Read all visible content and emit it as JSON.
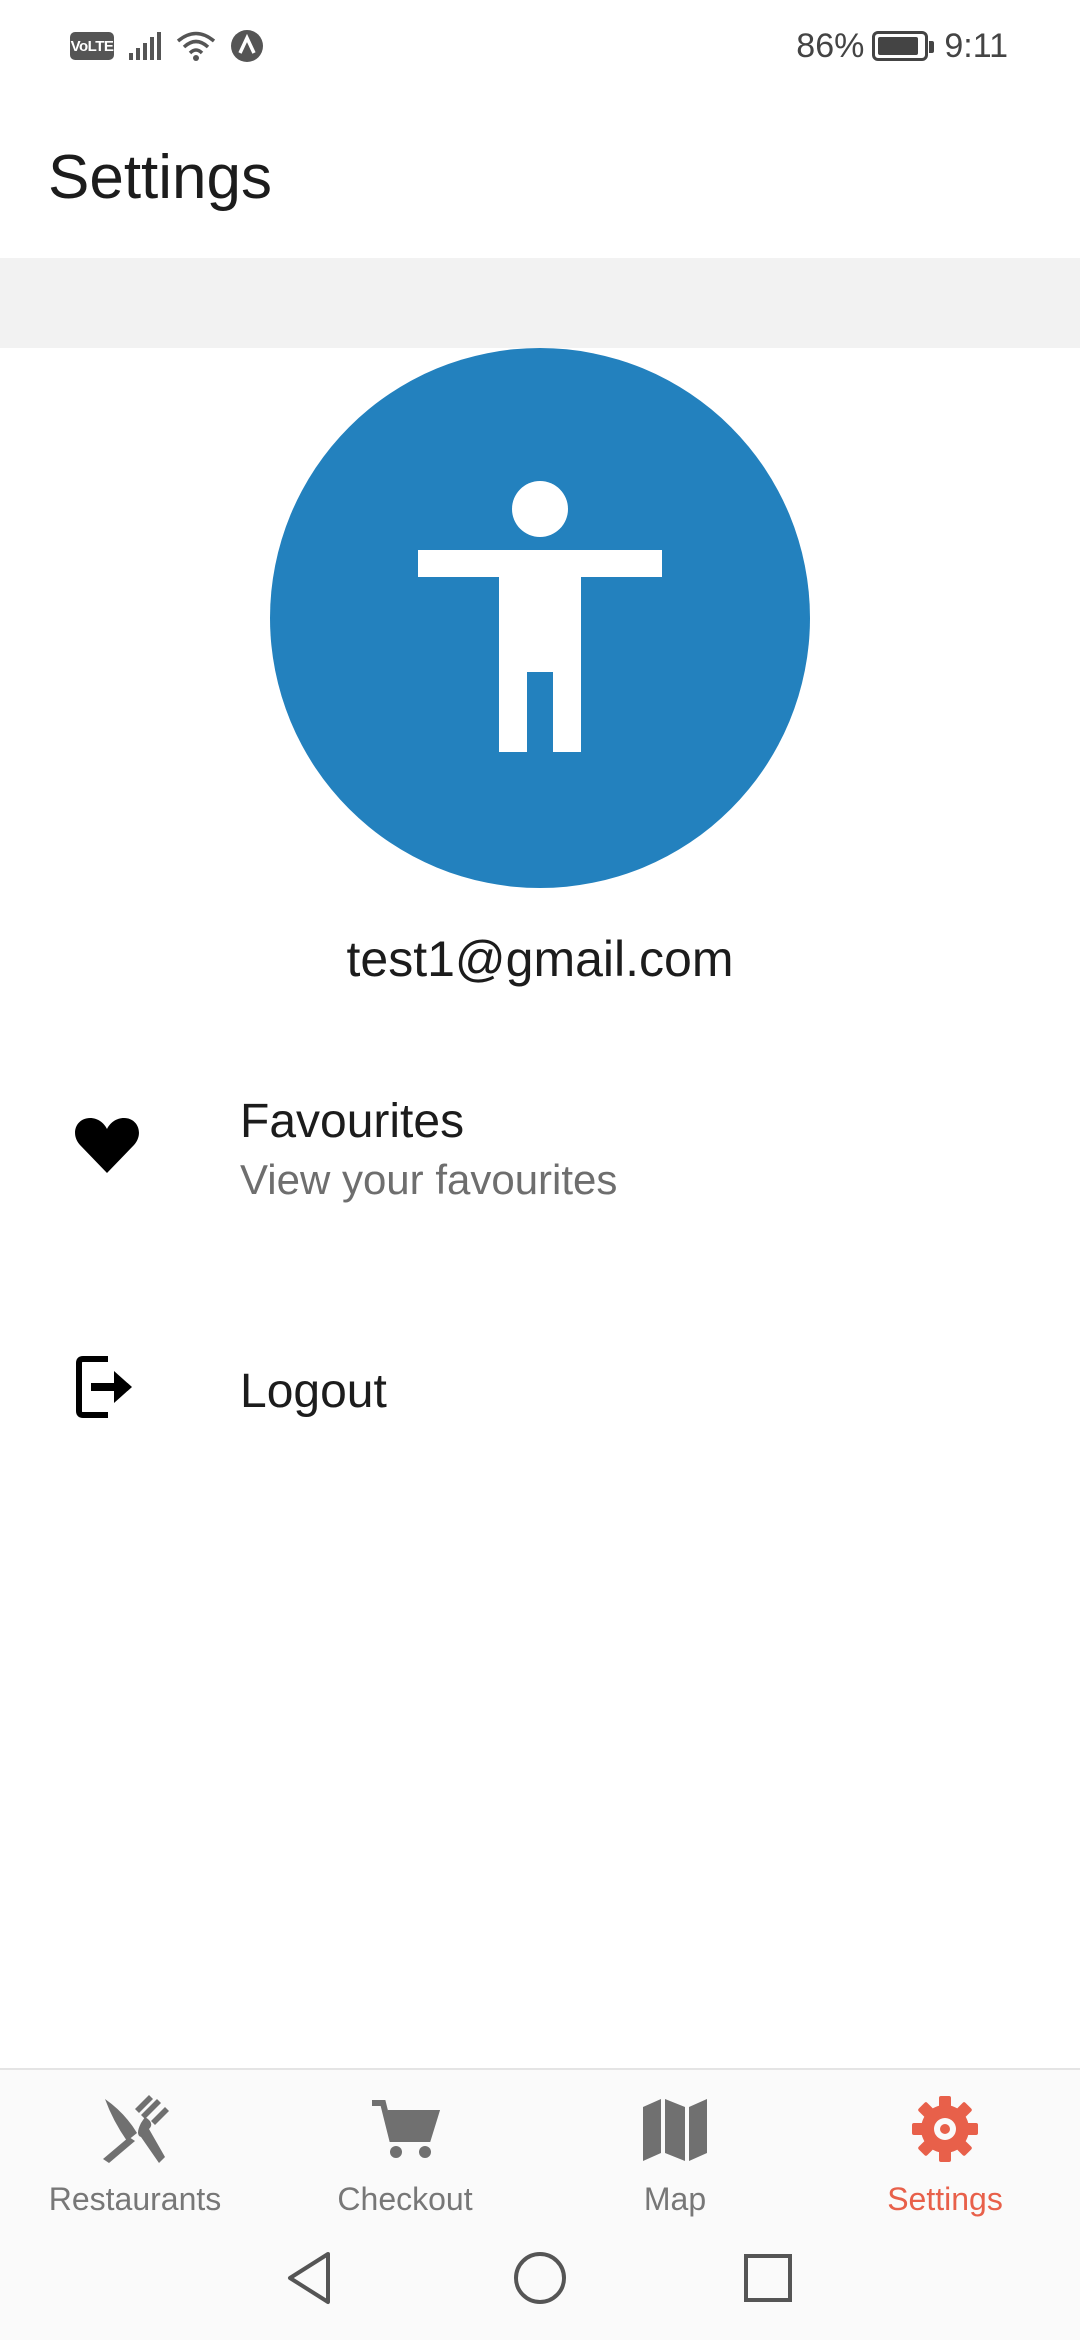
{
  "status_bar": {
    "volte": "VoLTE",
    "battery": "86%",
    "time": "9:11",
    "icons": [
      "volte-icon",
      "signal-icon",
      "wifi-icon",
      "app-notification-icon",
      "battery-icon"
    ]
  },
  "header": {
    "title": "Settings"
  },
  "profile": {
    "avatar_icon": "accessibility-person-icon",
    "avatar_color": "#2381be",
    "email": "test1@gmail.com"
  },
  "menu": {
    "items": [
      {
        "icon": "heart-icon",
        "title": "Favourites",
        "subtitle": "View your favourites"
      },
      {
        "icon": "logout-icon",
        "title": "Logout"
      }
    ]
  },
  "bottom_nav": {
    "active": "Settings",
    "active_color": "#e8604a",
    "tabs": [
      {
        "icon": "fork-knife-icon",
        "label": "Restaurants"
      },
      {
        "icon": "cart-icon",
        "label": "Checkout"
      },
      {
        "icon": "map-icon",
        "label": "Map"
      },
      {
        "icon": "gear-icon",
        "label": "Settings"
      }
    ]
  },
  "system_nav": {
    "buttons": [
      "back-icon",
      "home-icon",
      "recents-icon"
    ]
  }
}
